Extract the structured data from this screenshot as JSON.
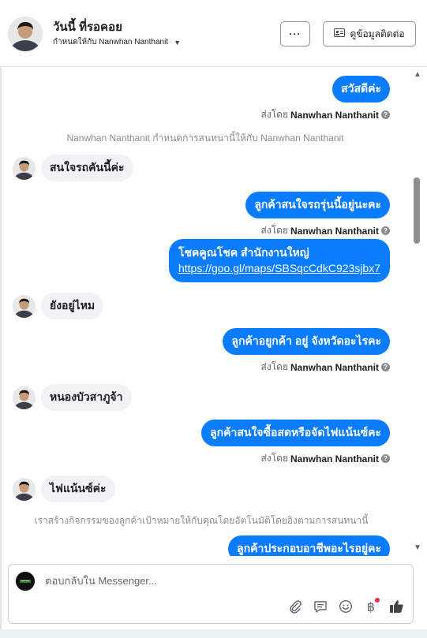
{
  "header": {
    "name": "วันนี้ ที่รอคอย",
    "assigned_text": "กำหนดให้กับ Nanwhan Nanthanit",
    "more_label": "···",
    "contact_label": "ดูข้อมูลติดต่อ"
  },
  "messages": {
    "out1": "สวัสดีค่ะ",
    "sent_prefix": "ส่งโดย",
    "sent_name": "Nanwhan Nanthanit",
    "system1": "Nanwhan Nanthanit กำหนดการสนทนานี้ให้กับ Nanwhan Nanthanit",
    "in1": "สนใจรถคันนี้ค่ะ",
    "out2": "ลูกค้าสนใจรถรุ่นนี้อยู่นะคะ",
    "out3_line1": "โชคคูณโชค สำนักงานใหญ่",
    "out3_link": "https://goo.gl/maps/SBSqcCdkC923sjbx7",
    "in2": "ยังอยู่ไหม",
    "out4": "ลูกค้าอยูกค้า อยู่ จังหวัดอะไรคะ",
    "in3": "หนองบัวสาภูจ้า",
    "out5": "ลูกค้าสนใจซื้อสดหรือจัดไฟแน้นซ์คะ",
    "in4": "ไฟแน้นซ์ค่ะ",
    "system2": "เราสร้างกิจกรรมของลูกค้าเป้าหมายให้กับคุณโดยอัตโนมัติโดยอิงตามการสนทนานี้",
    "out6": "ลูกค้าประกอบอาชีพอะไรอยู่คะ"
  },
  "composer": {
    "placeholder": "ตอบกลับใน Messenger..."
  },
  "icons": [
    "attach-icon",
    "saved-replies-icon",
    "emoji-icon",
    "baht-icon",
    "like-icon",
    "info-icon"
  ],
  "colors": {
    "outgoing_bubble": "#0a7cff",
    "incoming_bubble": "#f0f2f5",
    "notification_dot": "#f02849"
  }
}
